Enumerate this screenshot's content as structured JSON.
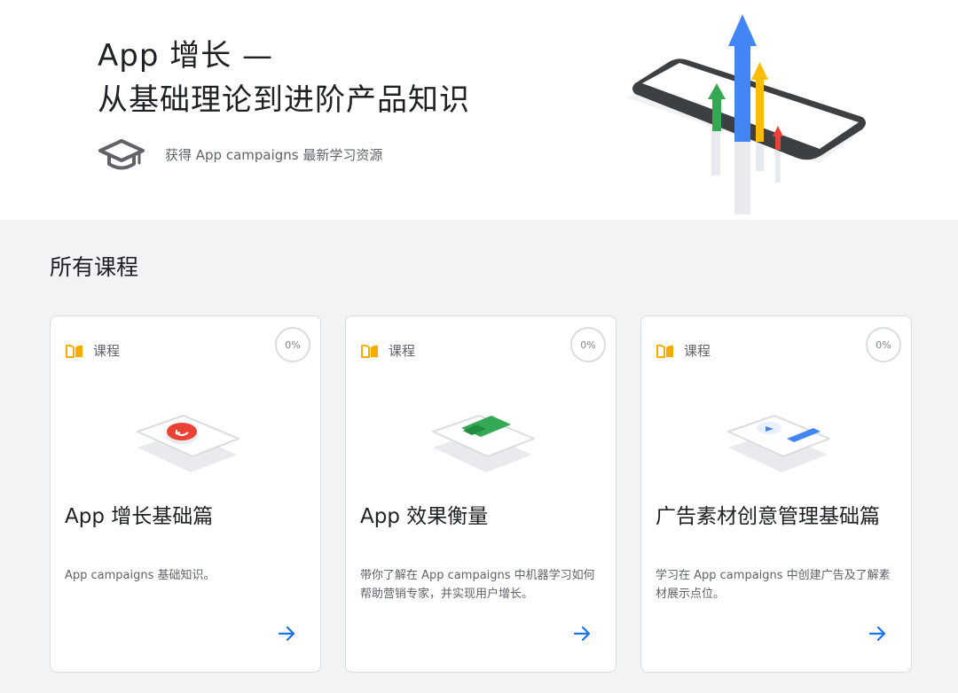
{
  "hero": {
    "title_line1": "App 增长 —",
    "title_line2": "从基础理论到进阶产品知识",
    "subtitle": "获得 App campaigns 最新学习资源"
  },
  "section": {
    "title": "所有课程"
  },
  "cards": [
    {
      "tag": "课程",
      "progress": "0%",
      "title": "App 增长基础篇",
      "description": "App campaigns 基础知识。",
      "illustration": "phone-red-button-icon"
    },
    {
      "tag": "课程",
      "progress": "0%",
      "title": "App 效果衡量",
      "description": "带你了解在 App campaigns 中机器学习如何帮助营销专家，并实现用户增长。",
      "illustration": "phone-green-card-icon"
    },
    {
      "tag": "课程",
      "progress": "0%",
      "title": "广告素材创意管理基础篇",
      "description": "学习在 App campaigns 中创建广告及了解素材展示点位。",
      "illustration": "phone-blue-video-icon"
    }
  ],
  "colors": {
    "blue": "#4285f4",
    "red": "#ea4335",
    "yellow": "#fbbc04",
    "green": "#34a853",
    "tag_icon": "#f9ab00",
    "arrow": "#1a73e8"
  }
}
